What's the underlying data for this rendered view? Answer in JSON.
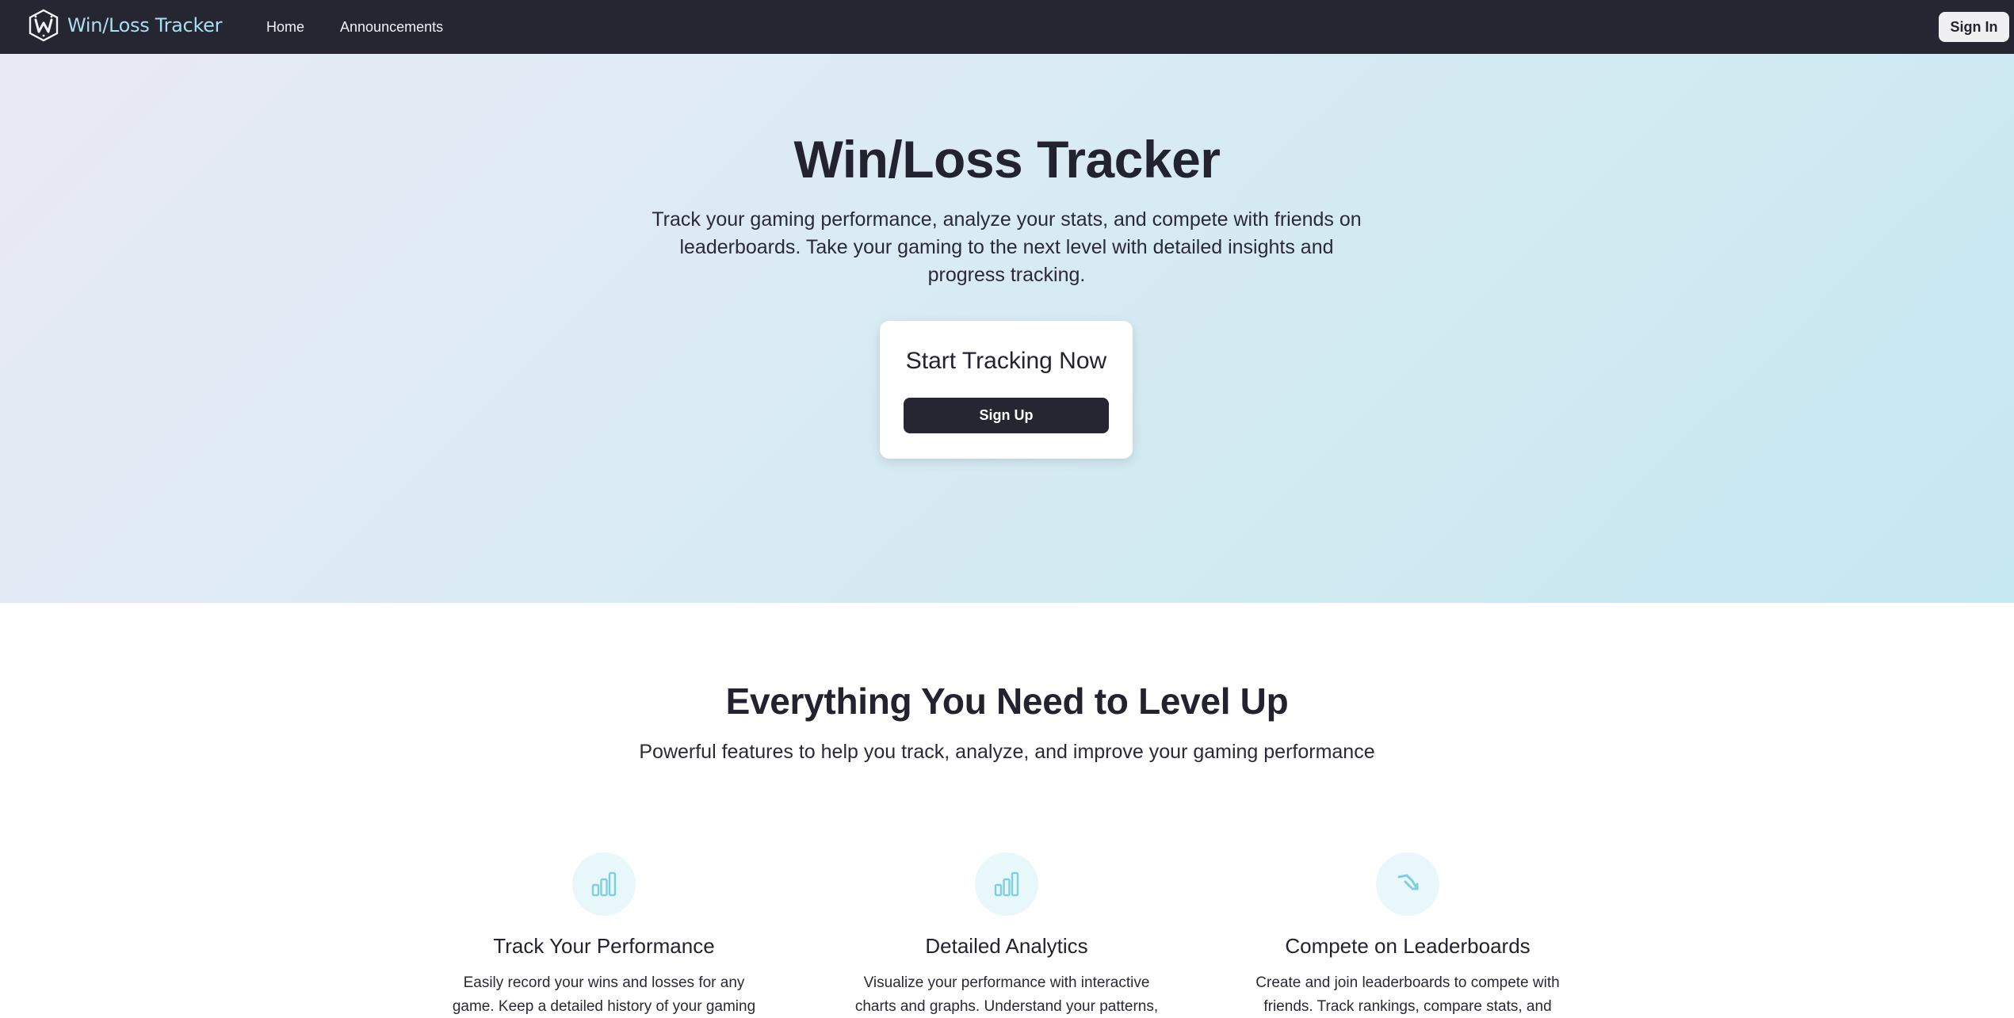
{
  "nav": {
    "brand": "Win/Loss Tracker",
    "links": [
      "Home",
      "Announcements"
    ],
    "signin_label": "Sign In"
  },
  "hero": {
    "title": "Win/Loss Tracker",
    "subtitle": "Track your gaming performance, analyze your stats, and compete with friends on leaderboards. Take your gaming to the next level with detailed insights and progress tracking.",
    "cta_title": "Start Tracking Now",
    "cta_button": "Sign Up"
  },
  "features": {
    "title": "Everything You Need to Level Up",
    "subtitle": "Powerful features to help you track, analyze, and improve your gaming performance",
    "items": [
      {
        "icon": "bar-chart-icon",
        "title": "Track Your Performance",
        "desc": "Easily record your wins and losses for any game. Keep a detailed history of your gaming"
      },
      {
        "icon": "bar-chart-icon",
        "title": "Detailed Analytics",
        "desc": "Visualize your performance with interactive charts and graphs. Understand your patterns,"
      },
      {
        "icon": "podium-icon",
        "title": "Compete on Leaderboards",
        "desc": "Create and join leaderboards to compete with friends. Track rankings, compare stats, and"
      }
    ]
  },
  "colors": {
    "navbar": "#262633",
    "brand_text": "#a8dff0",
    "icon_accent": "#7fcfe0",
    "icon_bg": "#e8f7fa"
  }
}
